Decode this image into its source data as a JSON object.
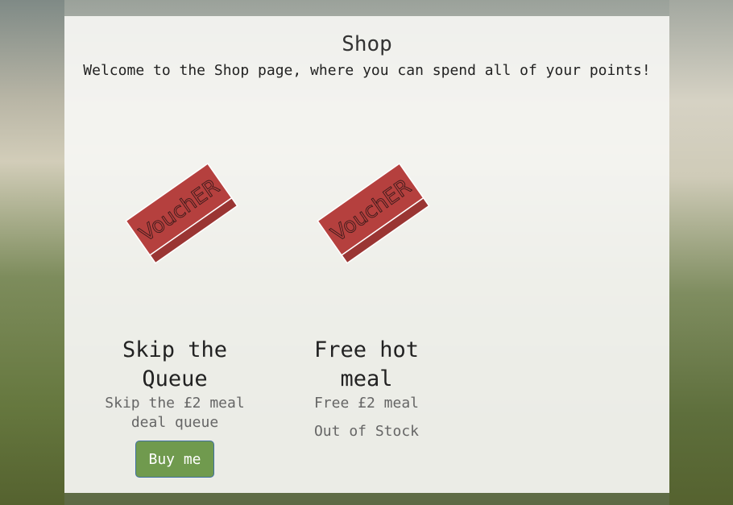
{
  "page": {
    "title": "Shop",
    "subtitle": "Welcome to the Shop page, where you can spend all of your points!"
  },
  "items": [
    {
      "name": "Skip the Queue",
      "description": "Skip the £2 meal deal queue",
      "button_label": "Buy me",
      "image_text": "VouchER"
    },
    {
      "name": "Free hot meal",
      "description": "Free £2 meal",
      "status": "Out of Stock",
      "image_text": "VouchER"
    }
  ],
  "colors": {
    "voucher_red": "#b5403e",
    "button_green": "#709a4e"
  }
}
